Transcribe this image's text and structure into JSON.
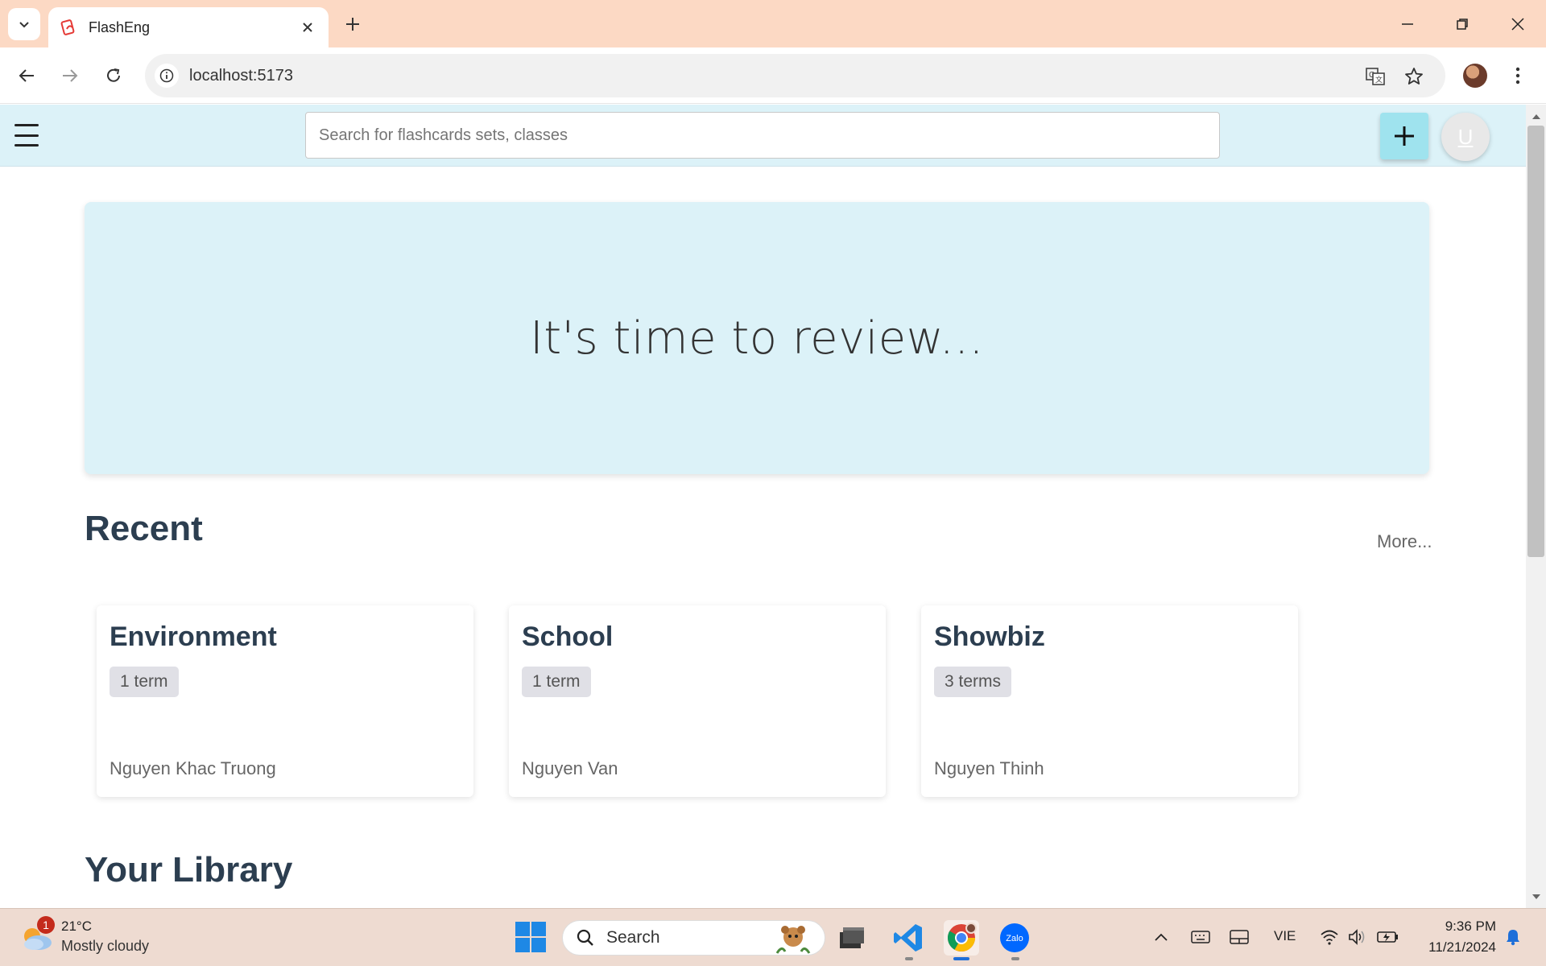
{
  "browser": {
    "tab_title": "FlashEng",
    "url": "localhost:5173"
  },
  "app": {
    "search_placeholder": "Search for flashcards sets, classes",
    "avatar_initial": "U",
    "hero_text": "It's time to review...",
    "recent_title": "Recent",
    "more_label": "More...",
    "library_title": "Your Library",
    "cards": [
      {
        "title": "Environment",
        "terms": "1 term",
        "author": "Nguyen Khac Truong"
      },
      {
        "title": "School",
        "terms": "1 term",
        "author": "Nguyen Van"
      },
      {
        "title": "Showbiz",
        "terms": "3 terms",
        "author": "Nguyen Thinh"
      }
    ]
  },
  "taskbar": {
    "weather_badge": "1",
    "weather_temp": "21°C",
    "weather_desc": "Mostly cloudy",
    "search_label": "Search",
    "language": "VIE",
    "time": "9:36 PM",
    "date": "11/21/2024"
  },
  "colors": {
    "header_bg": "#dcf2f8",
    "add_button_bg": "#9fe3ee",
    "tabstrip_bg": "#fcd9c4",
    "taskbar_bg": "#eedbd1"
  }
}
